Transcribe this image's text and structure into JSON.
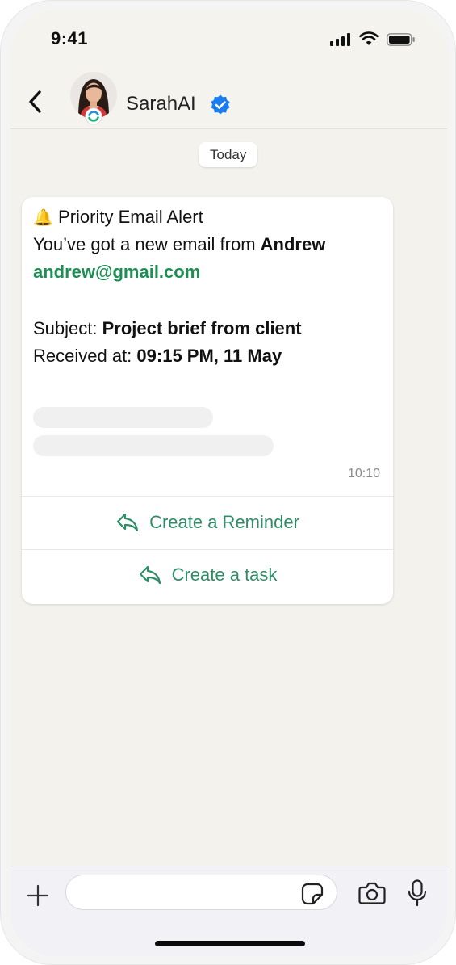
{
  "status_bar": {
    "time": "9:41"
  },
  "header": {
    "contact_name": "SarahAI",
    "icons": {
      "back": "chevron-left-icon",
      "verified": "verified-badge-icon",
      "avatar_badge": "app-logo-icon"
    }
  },
  "chat": {
    "date_label": "Today",
    "message": {
      "alert_title": "Priority Email Alert",
      "alert_emoji": "🔔",
      "intro_text": "You’ve got a new email from ",
      "sender_name": "Andrew",
      "sender_email": "andrew@gmail.com",
      "subject_label": "Subject: ",
      "subject_value": "Project brief from client",
      "received_label": "Received at: ",
      "received_value": "09:15 PM, 11 May",
      "time": "10:10"
    },
    "actions": [
      {
        "label": "Create a Reminder",
        "icon": "reply-arrow-icon"
      },
      {
        "label": "Create a task",
        "icon": "reply-arrow-icon"
      }
    ]
  },
  "input_bar": {
    "placeholder": "",
    "icons": [
      "plus-icon",
      "sticker-icon",
      "camera-icon",
      "microphone-icon"
    ]
  },
  "colors": {
    "accent_green": "#2f8d67",
    "email_green": "#1d8e54",
    "verified_blue": "#1a7cf0",
    "chat_background": "#f4f2ed"
  }
}
